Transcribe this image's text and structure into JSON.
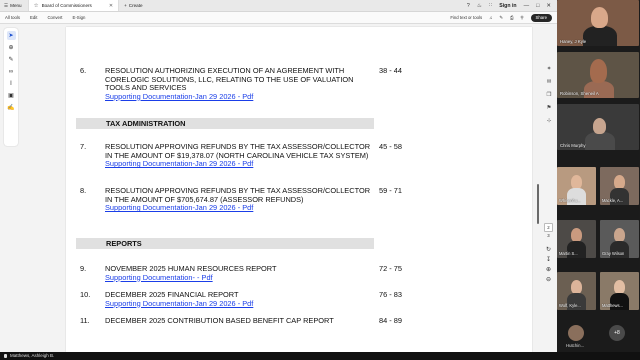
{
  "app": {
    "menu_label": "Menu",
    "tab_title": "Board of Commissioners",
    "create_label": "Create",
    "signin_label": "Sign in"
  },
  "toolbar": {
    "all_tools": "All tools",
    "edit": "Edit",
    "convert": "Convert",
    "esign": "E-Sign",
    "find": "Find text or tools",
    "share": "Share"
  },
  "document": {
    "items_top": [
      {
        "num": "6.",
        "desc": "RESOLUTION AUTHORIZING EXECUTION OF AN AGREEMENT WITH CORELOGIC SOLUTIONS, LLC, RELATING TO THE USE OF VALUATION TOOLS AND SERVICES",
        "pages": "38 - 44",
        "link": "Supporting Documentation-Jan 29 2026 - Pdf"
      }
    ],
    "section_tax": "TAX ADMINISTRATION",
    "items_tax": [
      {
        "num": "7.",
        "desc": "RESOLUTION APPROVING REFUNDS BY THE TAX ASSESSOR/COLLECTOR IN THE AMOUNT OF $19,378.07 (NORTH CAROLINA VEHICLE TAX SYSTEM)",
        "pages": "45 - 58",
        "link": "Supporting Documentation-Jan 29 2026 - Pdf"
      },
      {
        "num": "8.",
        "desc": "RESOLUTION APPROVING REFUNDS BY THE TAX ASSESSOR/COLLECTOR IN THE AMOUNT OF $705,674.87 (ASSESSOR REFUNDS)",
        "pages": "59 - 71",
        "link": "Supporting Documentation-Jan 29 2026 - Pdf"
      }
    ],
    "section_reports": "REPORTS",
    "items_reports": [
      {
        "num": "9.",
        "desc": "NOVEMBER 2025 HUMAN RESOURCES REPORT",
        "pages": "72 - 75",
        "link": "Supporting Documentation- - Pdf"
      },
      {
        "num": "10.",
        "desc": "DECEMBER 2025 FINANCIAL REPORT",
        "pages": "76 - 83",
        "link": "Supporting Documentation-Jan 29 2026 - Pdf"
      },
      {
        "num": "11.",
        "desc": "DECEMBER 2025 CONTRIBUTION BASED BENEFIT CAP REPORT",
        "pages": "84 - 89",
        "link": ""
      }
    ]
  },
  "page_nav": {
    "current": "2",
    "total": "3"
  },
  "participants": {
    "tiles": [
      "Haney, J Kyle",
      "Robinson, Sheneil A",
      "Chris Murphy"
    ],
    "minis": [
      "Whisenhu...",
      "Mackle, A...",
      "Martin S...",
      "Gray Wilson",
      "Wolf, Kyle...",
      "Matthews..."
    ],
    "bottom_name": "Hutchin...",
    "more_count": "+8"
  },
  "bottom_bar": {
    "speaker": "Matthews, Ashleigh B."
  },
  "colors": {
    "link": "#1a3ee8",
    "section_bg": "#e0e0e0"
  }
}
